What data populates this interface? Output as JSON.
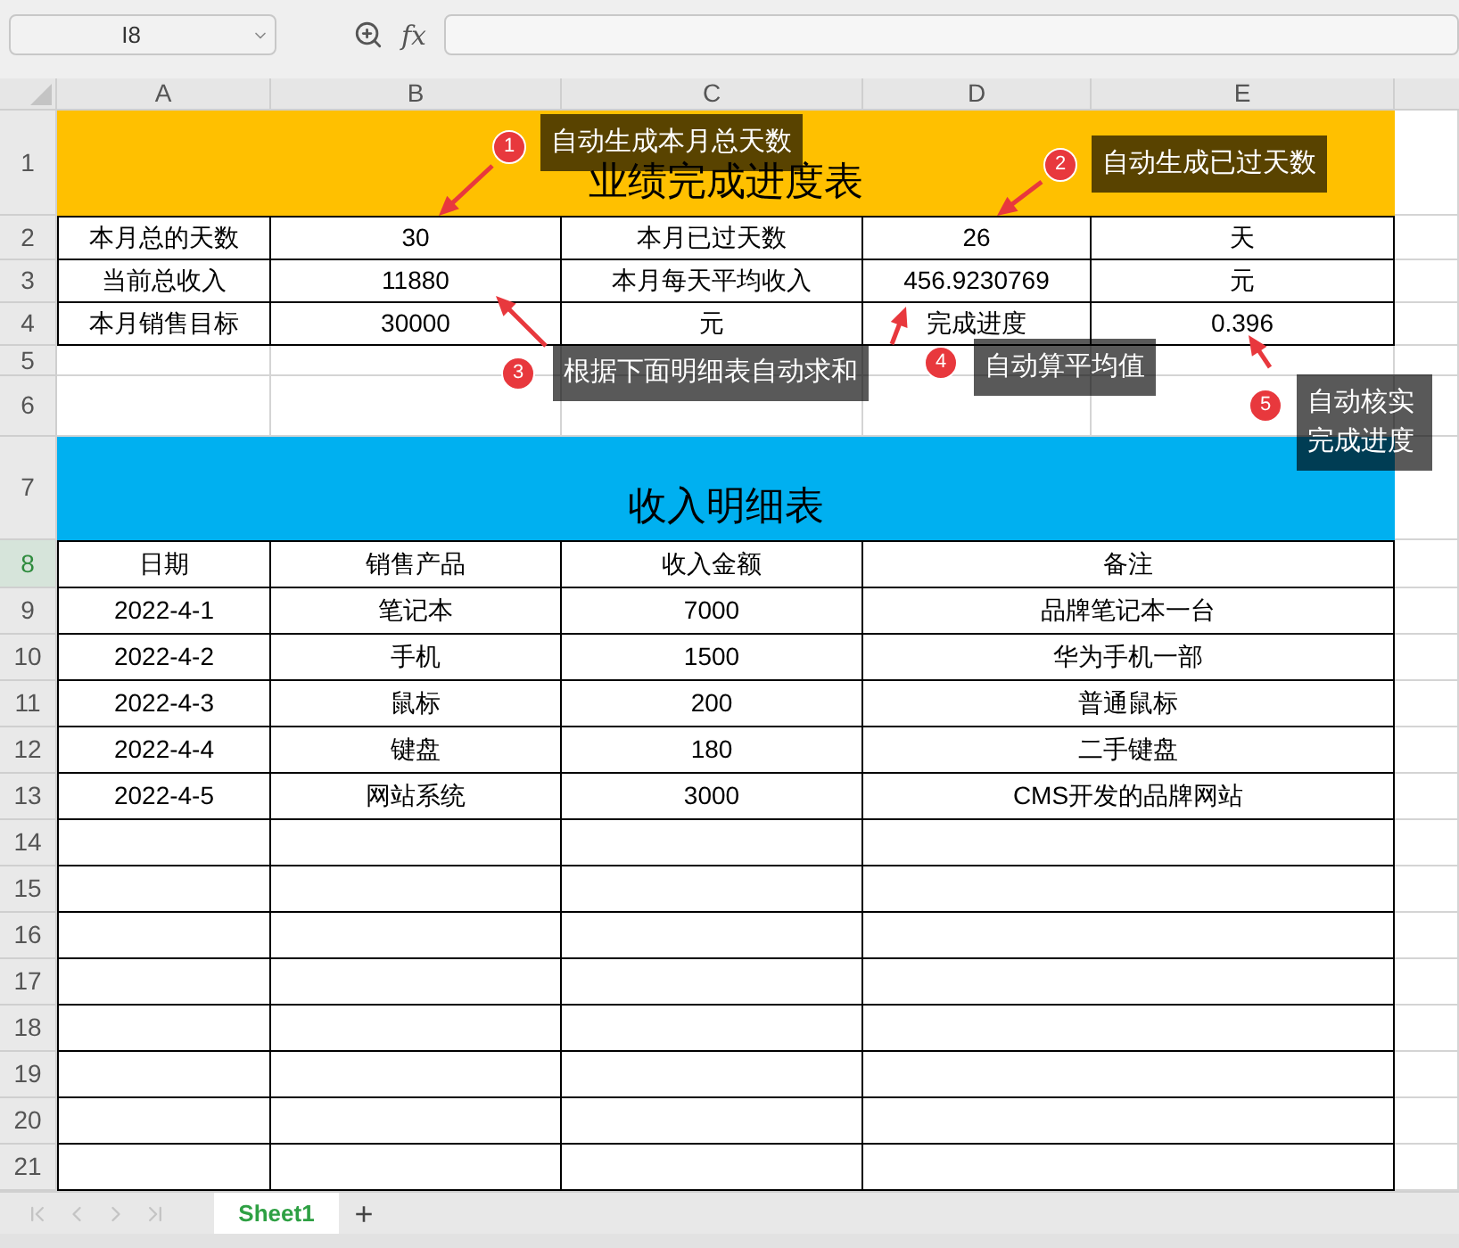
{
  "formula_bar": {
    "name_box": "I8",
    "fx": "fx"
  },
  "columns": [
    {
      "label": "A",
      "selected": false
    },
    {
      "label": "B",
      "selected": false
    },
    {
      "label": "C",
      "selected": false
    },
    {
      "label": "D",
      "selected": false
    },
    {
      "label": "E",
      "selected": false
    }
  ],
  "rows": [
    {
      "number": "1",
      "selected": false,
      "kind": "banner",
      "color": "#ffc000",
      "title": "业绩完成进度表"
    },
    {
      "number": "2",
      "selected": false,
      "kind": "cells",
      "cells": [
        "本月总的天数",
        "30",
        "本月已过天数",
        "26",
        "天"
      ]
    },
    {
      "number": "3",
      "selected": false,
      "kind": "cells",
      "cells": [
        "当前总收入",
        "11880",
        "本月每天平均收入",
        "456.9230769",
        "元"
      ]
    },
    {
      "number": "4",
      "selected": false,
      "kind": "cells",
      "cells": [
        "本月销售目标",
        "30000",
        "元",
        "完成进度",
        "0.396"
      ]
    },
    {
      "number": "5",
      "selected": false,
      "kind": "blank"
    },
    {
      "number": "6",
      "selected": false,
      "kind": "blank"
    },
    {
      "number": "7",
      "selected": false,
      "kind": "banner",
      "color": "#00b0f0",
      "title": "收入明细表"
    },
    {
      "number": "8",
      "selected": true,
      "kind": "detail",
      "cells": [
        "日期",
        "销售产品",
        "收入金额",
        "备注"
      ]
    },
    {
      "number": "9",
      "selected": false,
      "kind": "detail",
      "cells": [
        "2022-4-1",
        "笔记本",
        "7000",
        "品牌笔记本一台"
      ]
    },
    {
      "number": "10",
      "selected": false,
      "kind": "detail",
      "cells": [
        "2022-4-2",
        "手机",
        "1500",
        "华为手机一部"
      ]
    },
    {
      "number": "11",
      "selected": false,
      "kind": "detail",
      "cells": [
        "2022-4-3",
        "鼠标",
        "200",
        "普通鼠标"
      ]
    },
    {
      "number": "12",
      "selected": false,
      "kind": "detail",
      "cells": [
        "2022-4-4",
        "键盘",
        "180",
        "二手键盘"
      ]
    },
    {
      "number": "13",
      "selected": false,
      "kind": "detail",
      "cells": [
        "2022-4-5",
        "网站系统",
        "3000",
        "CMS开发的品牌网站"
      ]
    },
    {
      "number": "14",
      "selected": false,
      "kind": "empty_detail"
    },
    {
      "number": "15",
      "selected": false,
      "kind": "empty_detail"
    },
    {
      "number": "16",
      "selected": false,
      "kind": "empty_detail"
    },
    {
      "number": "17",
      "selected": false,
      "kind": "empty_detail"
    },
    {
      "number": "18",
      "selected": false,
      "kind": "empty_detail"
    },
    {
      "number": "19",
      "selected": false,
      "kind": "empty_detail"
    },
    {
      "number": "20",
      "selected": false,
      "kind": "empty_detail"
    },
    {
      "number": "21",
      "selected": false,
      "kind": "empty_detail"
    }
  ],
  "callouts": [
    {
      "number": "1",
      "text": "自动生成本月总天数"
    },
    {
      "number": "2",
      "text": "自动生成已过天数"
    },
    {
      "number": "3",
      "text": "根据下面明细表自动求和"
    },
    {
      "number": "4",
      "text": "自动算平均值"
    },
    {
      "number": "5",
      "text": "自动核实完成进度"
    }
  ],
  "sheet_tabs": [
    {
      "label": "Sheet1",
      "selected": true
    }
  ],
  "add_sheet": "+"
}
